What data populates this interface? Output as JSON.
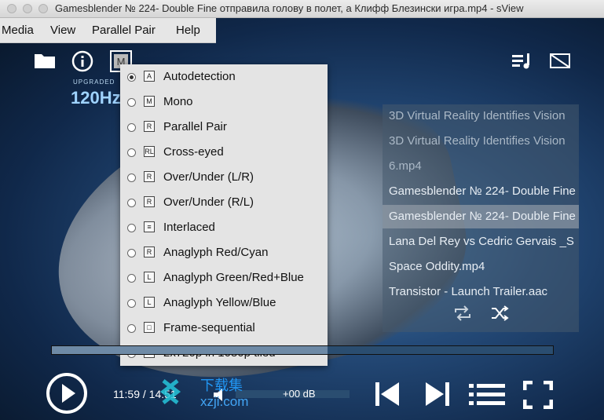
{
  "window": {
    "title": "Gamesblender № 224- Double Fine отправила голову в полет, а Клифф Блезински игра.mp4 - sView"
  },
  "menubar": [
    "Media",
    "View",
    "Parallel Pair",
    "Help"
  ],
  "overlay": {
    "upgraded": "UPGRADED",
    "hz": "120Hz"
  },
  "stereo_menu": {
    "selected_index": 0,
    "items": [
      {
        "label": "Autodetection",
        "icon": "A"
      },
      {
        "label": "Mono",
        "icon": "M"
      },
      {
        "label": "Parallel Pair",
        "icon": "R"
      },
      {
        "label": "Cross-eyed",
        "icon": "RL"
      },
      {
        "label": "Over/Under (L/R)",
        "icon": "R"
      },
      {
        "label": "Over/Under (R/L)",
        "icon": "R"
      },
      {
        "label": "Interlaced",
        "icon": "≡"
      },
      {
        "label": "Anaglyph Red/Cyan",
        "icon": "R"
      },
      {
        "label": "Anaglyph Green/Red+Blue",
        "icon": "L"
      },
      {
        "label": "Anaglyph Yellow/Blue",
        "icon": "L"
      },
      {
        "label": "Frame-sequential",
        "icon": "□"
      },
      {
        "label": "2x720p in 1080p tiled",
        "icon": "R"
      }
    ]
  },
  "playlist": {
    "items": [
      {
        "label": "3D Virtual Reality Identifies Vision",
        "state": "dim"
      },
      {
        "label": "3D Virtual Reality Identifies Vision",
        "state": "dim"
      },
      {
        "label": "6.mp4",
        "state": "dim"
      },
      {
        "label": "Gamesblender № 224- Double Fine",
        "state": "normal"
      },
      {
        "label": "Gamesblender № 224- Double Fine",
        "state": "selected"
      },
      {
        "label": "Lana Del Rey vs Cedric Gervais _S",
        "state": "normal"
      },
      {
        "label": "Space Oddity.mp4",
        "state": "normal"
      },
      {
        "label": "Transistor - Launch Trailer.aac",
        "state": "normal"
      }
    ]
  },
  "controls": {
    "time": "11:59 / 14:51",
    "volume_db": "+00 dB",
    "progress": 0.55
  },
  "watermark": {
    "text1": "下载集",
    "text2": "xzji.com"
  },
  "colors": {
    "accent": "#9fd3ff",
    "menu_bg": "#e4e4e4"
  }
}
